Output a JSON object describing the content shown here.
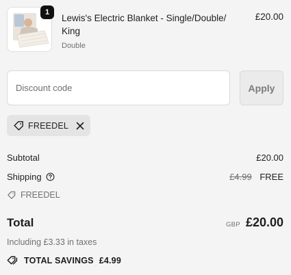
{
  "line_item": {
    "quantity": "1",
    "title": "Lewis's Electric Blanket - Single/Double/ King",
    "variant": "Double",
    "price": "£20.00"
  },
  "discount": {
    "placeholder": "Discount code",
    "apply_label": "Apply",
    "applied_code": "FREEDEL"
  },
  "summary": {
    "subtotal_label": "Subtotal",
    "subtotal_value": "£20.00",
    "shipping_label": "Shipping",
    "shipping_original": "£4.99",
    "shipping_value": "FREE",
    "applied_code": "FREEDEL",
    "total_label": "Total",
    "currency": "GBP",
    "total_value": "£20.00",
    "taxes_note": "Including £3.33 in taxes",
    "savings_label": "TOTAL SAVINGS",
    "savings_value": "£4.99"
  },
  "icons": {
    "tag": "tag-icon",
    "close": "close-icon",
    "help": "help-circle-icon",
    "savings": "savings-tag-icon"
  },
  "colors": {
    "background": "#f4f4f4",
    "badge": "#111111",
    "muted_text": "#707070",
    "tag_bg": "#e4e4e4"
  }
}
